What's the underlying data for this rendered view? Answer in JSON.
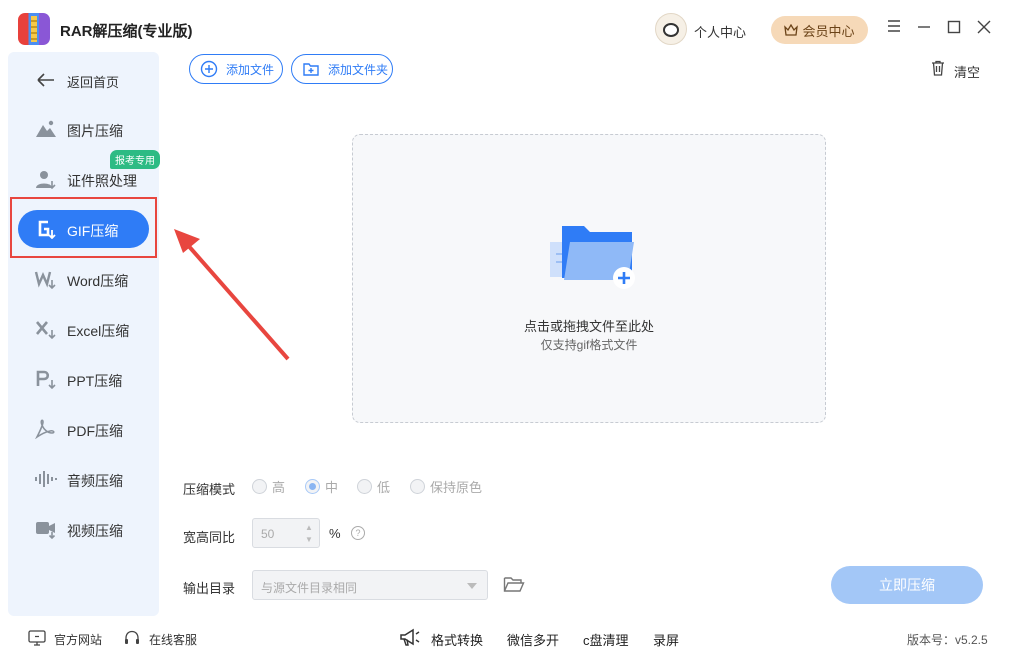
{
  "app": {
    "title": "RAR解压缩(专业版)"
  },
  "header": {
    "user_center": "个人中心",
    "vip_center": "会员中心"
  },
  "sidebar": {
    "back": "返回首页",
    "badge": "报考专用",
    "items": [
      {
        "label": "图片压缩",
        "icon": "image-icon"
      },
      {
        "label": "证件照处理",
        "icon": "id-photo-icon"
      },
      {
        "label": "GIF压缩",
        "icon": "gif-icon",
        "active": true
      },
      {
        "label": "Word压缩",
        "icon": "word-icon"
      },
      {
        "label": "Excel压缩",
        "icon": "excel-icon"
      },
      {
        "label": "PPT压缩",
        "icon": "ppt-icon"
      },
      {
        "label": "PDF压缩",
        "icon": "pdf-icon"
      },
      {
        "label": "音频压缩",
        "icon": "audio-icon"
      },
      {
        "label": "视频压缩",
        "icon": "video-icon"
      }
    ]
  },
  "toolbar": {
    "add_file": "添加文件",
    "add_folder": "添加文件夹",
    "clear": "清空"
  },
  "dropzone": {
    "main": "点击或拖拽文件至此处",
    "sub": "仅支持gif格式文件"
  },
  "settings": {
    "mode_label": "压缩模式",
    "modes": [
      "高",
      "中",
      "低",
      "保持原色"
    ],
    "selected_mode": "中",
    "ratio_label": "宽高同比",
    "ratio_value": "50",
    "ratio_unit": "%",
    "help": "?",
    "output_label": "输出目录",
    "output_value": "与源文件目录相同",
    "compress_button": "立即压缩"
  },
  "footer": {
    "website": "官方网站",
    "support": "在线客服",
    "tools": [
      "格式转换",
      "微信多开",
      "c盘清理",
      "录屏"
    ],
    "version": "版本号：v5.2.5"
  },
  "colors": {
    "accent": "#2f7cf6",
    "highlight_box": "#e8463f",
    "vip": "#f6d9b8"
  }
}
